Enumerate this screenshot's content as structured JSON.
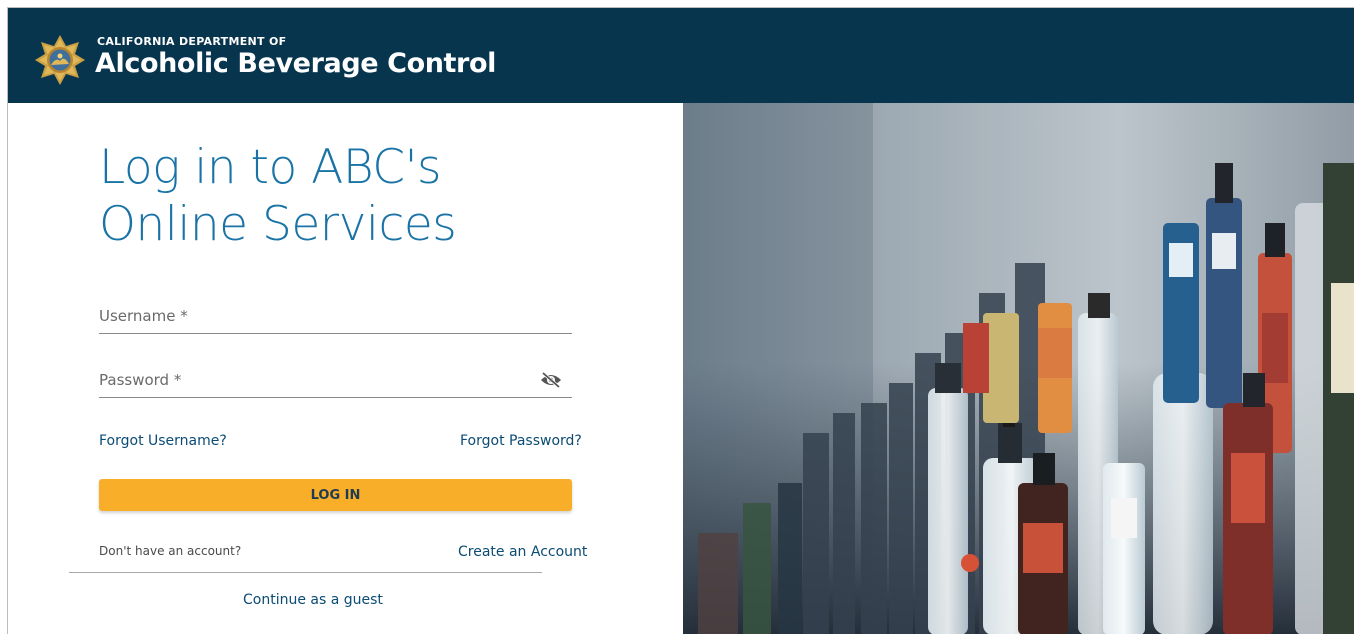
{
  "header": {
    "department": "CALIFORNIA DEPARTMENT OF",
    "brand": "Alcoholic Beverage Control",
    "seal_icon": "california-seal-icon",
    "background": "#08354e"
  },
  "login": {
    "title_line1": "Log in to ABC's",
    "title_line2": "Online Services",
    "username_placeholder": "Username *",
    "username_value": "",
    "password_placeholder": "Password *",
    "password_value": "",
    "password_toggle_icon": "eye-off-icon",
    "forgot_username": "Forgot Username?",
    "forgot_password": "Forgot Password?",
    "login_button": "LOG IN",
    "no_account_text": "Don't have an account?",
    "create_account": "Create an Account",
    "guest_link": "Continue as a guest"
  },
  "colors": {
    "accent": "#f9ae2a",
    "title": "#1a73a6",
    "link": "#0b4b74"
  },
  "hero_image": {
    "description_icon": "liquor-bottles-photo"
  }
}
